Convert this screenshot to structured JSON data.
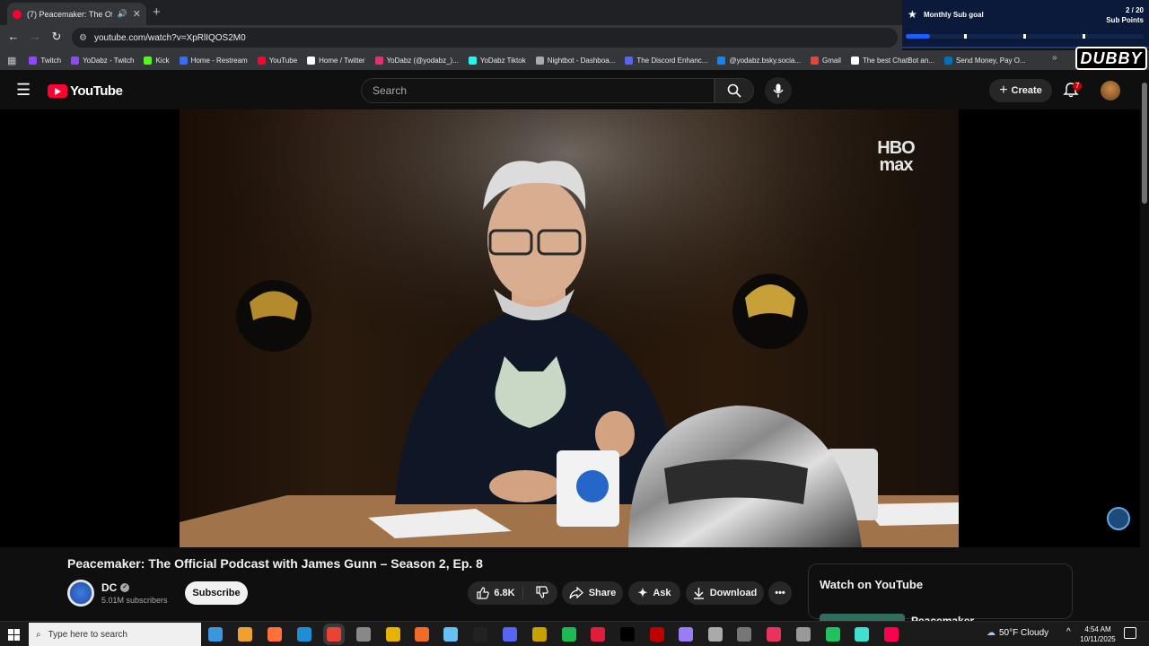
{
  "browser": {
    "tab_title": "(7) Peacemaker: The Officia",
    "address": "youtube.com/watch?v=XpRlIQOS2M0"
  },
  "sub_goal": {
    "label": "Monthly Sub goal",
    "count": "2 / 20",
    "unit": "Sub Points",
    "progress": 0.1
  },
  "bookmarks": [
    {
      "label": "Twitch",
      "color": "#9146ff"
    },
    {
      "label": "YoDabz - Twitch",
      "color": "#9146ff"
    },
    {
      "label": "Kick",
      "color": "#53fc18"
    },
    {
      "label": "Home - Restream",
      "color": "#3a6cf4"
    },
    {
      "label": "YouTube",
      "color": "#ff0033"
    },
    {
      "label": "Home / Twitter",
      "color": "#ffffff"
    },
    {
      "label": "YoDabz (@yodabz_)...",
      "color": "#e1306c"
    },
    {
      "label": "YoDabz Tiktok",
      "color": "#25f4ee"
    },
    {
      "label": "Nightbot - Dashboa...",
      "color": "#aaaaaa"
    },
    {
      "label": "The Discord Enhanc...",
      "color": "#5865f2"
    },
    {
      "label": "@yodabz.bsky.socia...",
      "color": "#1185fe"
    },
    {
      "label": "Gmail",
      "color": "#ea4335"
    },
    {
      "label": "The best ChatBot an...",
      "color": "#ffffff"
    },
    {
      "label": "Send Money, Pay O...",
      "color": "#0070ba"
    }
  ],
  "overlay": {
    "dubby": "DUBBY"
  },
  "youtube": {
    "logo_text": "YouTube",
    "search_placeholder": "Search",
    "create_label": "Create",
    "notification_count": "7"
  },
  "video": {
    "watermark": "HBO max",
    "title": "Peacemaker: The Official Podcast with James Gunn – Season 2, Ep. 8"
  },
  "channel": {
    "name": "DC",
    "subscribers": "5.01M subscribers",
    "subscribe_label": "Subscribe"
  },
  "actions": {
    "likes": "6.8K",
    "share": "Share",
    "ask": "Ask",
    "download": "Download"
  },
  "side_panel": {
    "title": "Watch on YouTube",
    "item": "Peacemaker"
  },
  "taskbar": {
    "search_placeholder": "Type here to search",
    "weather": "50°F  Cloudy",
    "time": "4:54 AM",
    "date": "10/11/2025",
    "app_colors": [
      "#3a96dd",
      "#f0a030",
      "#ff7139",
      "#1e8fd6",
      "#ea4335",
      "#888888",
      "#e8b200",
      "#f06a2a",
      "#66c0f4",
      "#222222",
      "#5865f2",
      "#c8a000",
      "#1db954",
      "#e01e3c",
      "#000000",
      "#c00000",
      "#9c7cf4",
      "#aaaaaa",
      "#777777",
      "#e8335a",
      "#999999",
      "#21c25e",
      "#40e0d0",
      "#ff004f"
    ]
  }
}
